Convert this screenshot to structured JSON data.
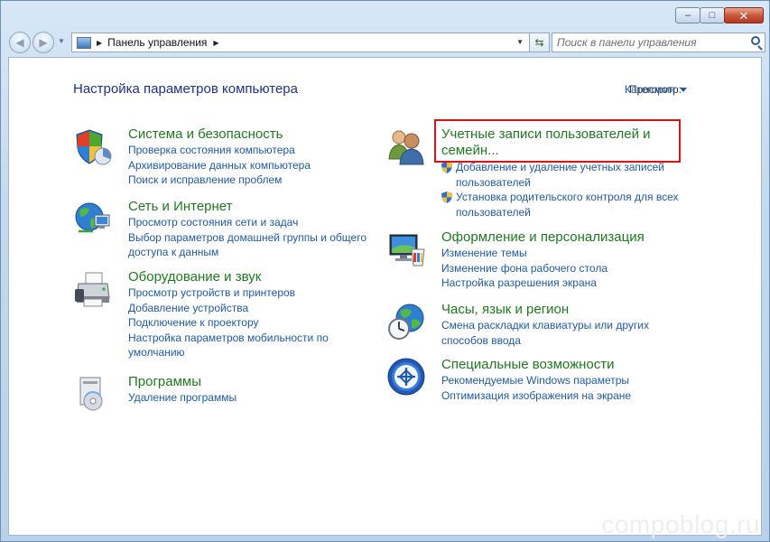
{
  "window": {
    "minimize_glyph": "–",
    "maximize_glyph": "□",
    "close_glyph": "✕"
  },
  "nav": {
    "back_glyph": "◀",
    "forward_glyph": "▶",
    "address_path": "Панель управления",
    "search_placeholder": "Поиск в панели управления"
  },
  "header": {
    "title": "Настройка параметров компьютера",
    "view_by_label": "Просмотр:",
    "view_by_value": "Категория"
  },
  "categories": [
    {
      "title": "Система и безопасность",
      "icon": "shield-pie-icon",
      "links": [
        "Проверка состояния компьютера",
        "Архивирование данных компьютера",
        "Поиск и исправление проблем"
      ]
    },
    {
      "title": "Сеть и Интернет",
      "icon": "globe-network-icon",
      "links": [
        "Просмотр состояния сети и задач",
        "Выбор параметров домашней группы и общего доступа к данным"
      ]
    },
    {
      "title": "Оборудование и звук",
      "icon": "printer-icon",
      "links": [
        "Просмотр устройств и принтеров",
        "Добавление устройства",
        "Подключение к проектору",
        "Настройка параметров мобильности по умолчанию"
      ]
    },
    {
      "title": "Программы",
      "icon": "programs-icon",
      "links": [
        "Удаление программы"
      ]
    },
    {
      "title": "Учетные записи пользователей и семейн...",
      "icon": "users-icon",
      "highlighted": true,
      "links": [
        "Добавление и удаление учетных записей пользователей",
        "Установка родительского контроля для всех пользователей"
      ]
    },
    {
      "title": "Оформление и персонализация",
      "icon": "monitor-palette-icon",
      "links": [
        "Изменение темы",
        "Изменение фона рабочего стола",
        "Настройка разрешения экрана"
      ]
    },
    {
      "title": "Часы, язык и регион",
      "icon": "clock-globe-icon",
      "links": [
        "Смена раскладки клавиатуры или других способов ввода"
      ]
    },
    {
      "title": "Специальные возможности",
      "icon": "accessibility-icon",
      "links": [
        "Рекомендуемые Windows параметры",
        "Оптимизация изображения на экране"
      ]
    }
  ],
  "watermark": "compoblog.ru",
  "colors": {
    "category_title": "#1e7a1e",
    "link": "#1e5aa8",
    "page_title": "#1e3287",
    "highlight_box": "#e01010"
  }
}
